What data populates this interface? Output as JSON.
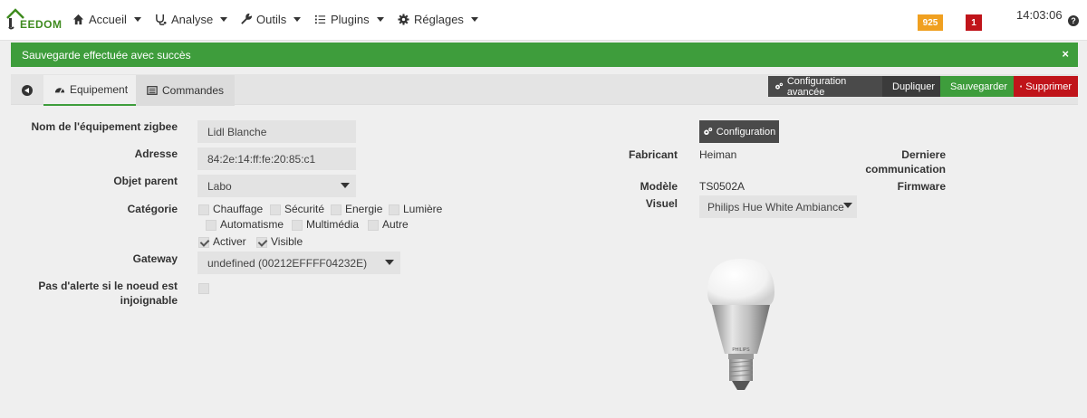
{
  "nav": {
    "logo_text": "EEDOM",
    "items": [
      {
        "label": "Accueil",
        "icon": "home-icon"
      },
      {
        "label": "Analyse",
        "icon": "stethoscope-icon"
      },
      {
        "label": "Outils",
        "icon": "wrench-icon"
      },
      {
        "label": "Plugins",
        "icon": "tasks-icon"
      },
      {
        "label": "Réglages",
        "icon": "gear-icon"
      }
    ],
    "badge_orange": "925",
    "badge_red": "1",
    "clock": "14:03:06",
    "help": "?"
  },
  "alert": {
    "message": "Sauvegarde effectuée avec succès",
    "close": "×"
  },
  "tabs": [
    {
      "label": "Equipement",
      "icon": "tachometer-icon"
    },
    {
      "label": "Commandes",
      "icon": "list-icon"
    }
  ],
  "actions": {
    "config_adv": "Configuration avancée",
    "duplicate": "Dupliquer",
    "save": "Sauvegarder",
    "delete": "Supprimer"
  },
  "form": {
    "name_label": "Nom de l'équipement zigbee",
    "name_value": "Lidl Blanche",
    "address_label": "Adresse",
    "address_value": "84:2e:14:ff:fe:20:85:c1",
    "parent_label": "Objet parent",
    "parent_value": "Labo",
    "category_label": "Catégorie",
    "categories": [
      {
        "label": "Chauffage",
        "checked": false
      },
      {
        "label": "Sécurité",
        "checked": false
      },
      {
        "label": "Energie",
        "checked": false
      },
      {
        "label": "Lumière",
        "checked": false
      },
      {
        "label": "Automatisme",
        "checked": false
      },
      {
        "label": "Multimédia",
        "checked": false
      },
      {
        "label": "Autre",
        "checked": false
      }
    ],
    "activate_label": "Activer",
    "visible_label": "Visible",
    "gateway_label": "Gateway",
    "gateway_value": "undefined (00212EFFFF04232E)",
    "alert_label_1": "Pas d'alerte si le noeud est",
    "alert_label_2": "injoignable"
  },
  "info": {
    "config_button": "Configuration",
    "manufacturer_label": "Fabricant",
    "manufacturer_value": "Heiman",
    "last_comm_label_1": "Derniere",
    "last_comm_label_2": "communication",
    "model_label": "Modèle",
    "model_value": "TS0502A",
    "firmware_label": "Firmware",
    "visual_label": "Visuel",
    "visual_value": "Philips Hue White Ambiance",
    "bulb_brand": "PHILIPS"
  },
  "colors": {
    "accent_green": "#3e9d3c",
    "danger_red": "#c0141a",
    "badge_orange": "#f0a020"
  }
}
